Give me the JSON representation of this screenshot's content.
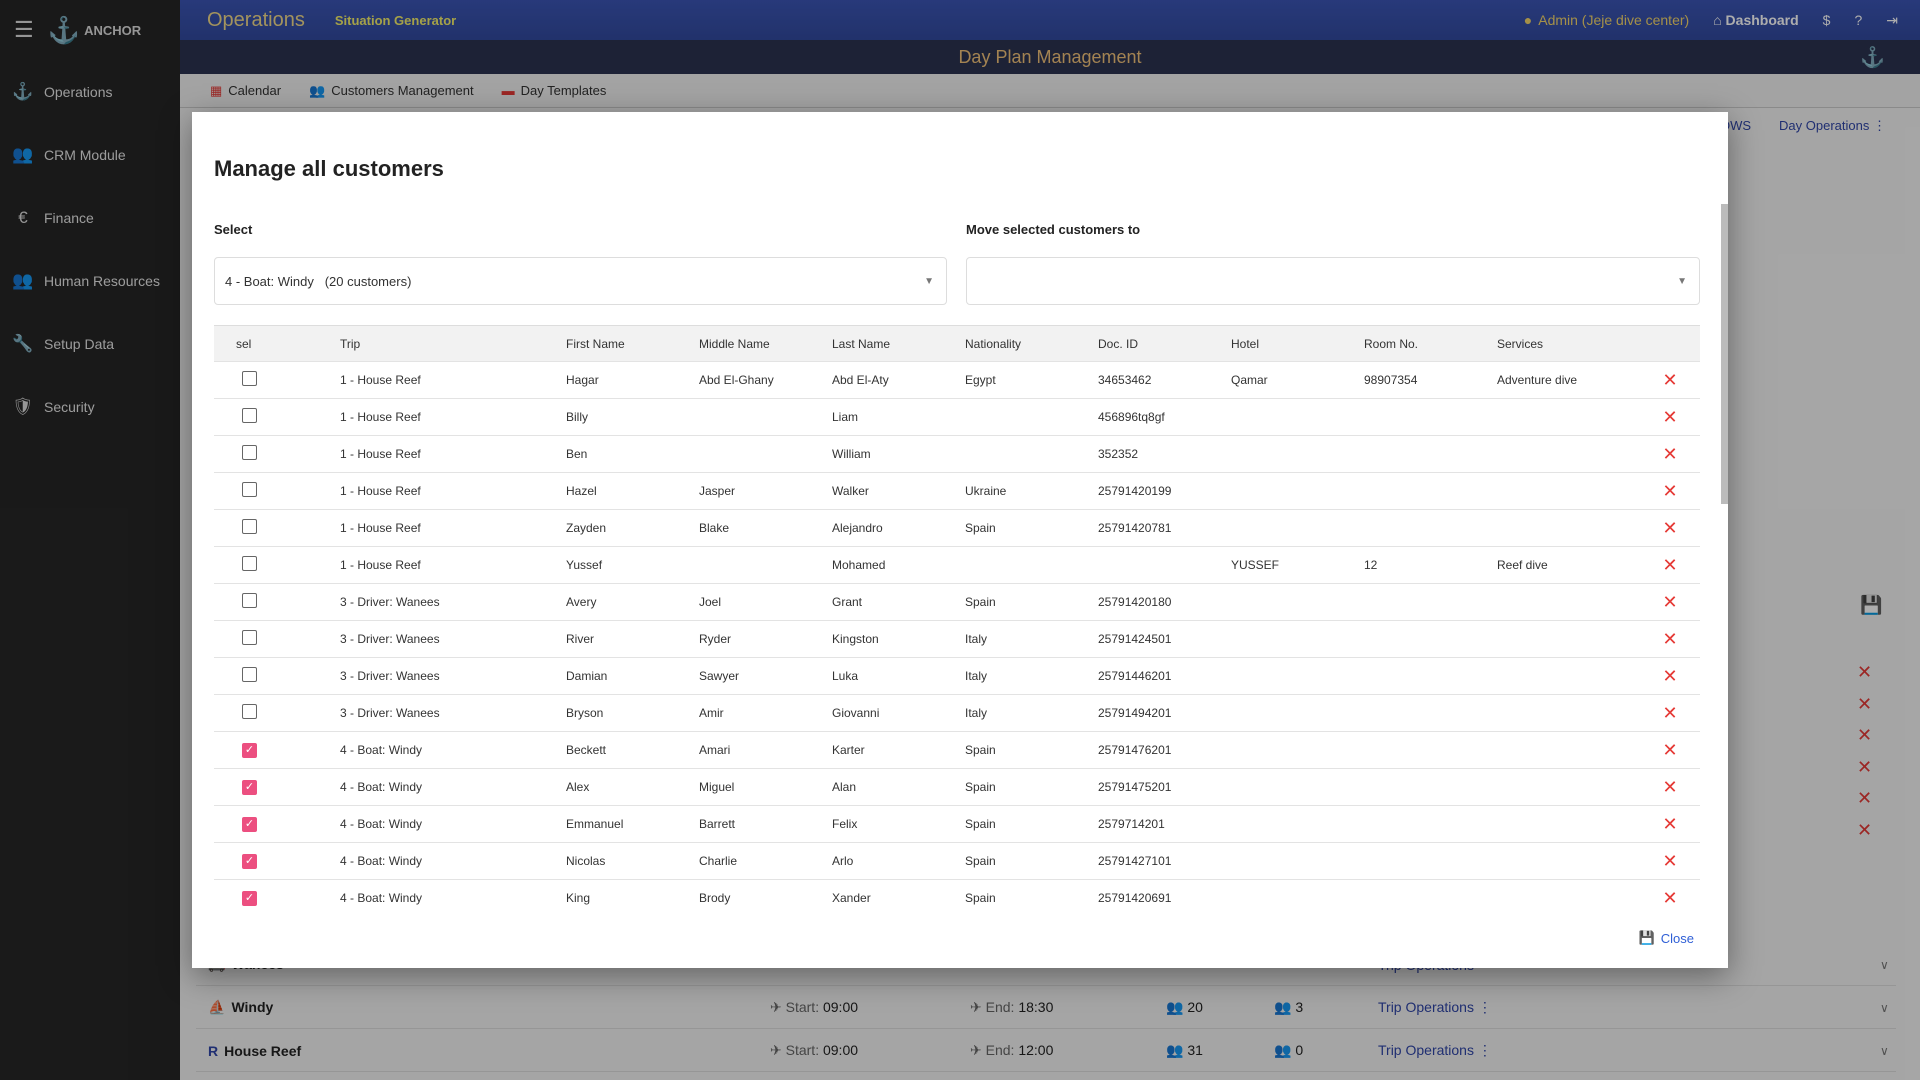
{
  "sidebar": {
    "logo": "ANCHOR",
    "items": [
      {
        "label": "Operations",
        "icon": "anchor-icon"
      },
      {
        "label": "CRM Module",
        "icon": "group-icon"
      },
      {
        "label": "Finance",
        "icon": "euro-icon"
      },
      {
        "label": "Human Resources",
        "icon": "people-icon"
      },
      {
        "label": "Setup Data",
        "icon": "wrench-icon"
      },
      {
        "label": "Security",
        "icon": "shield-icon"
      }
    ]
  },
  "topbar": {
    "app_title": "Operations",
    "situation": "Situation Generator",
    "user": "Admin (Jeje dive center)",
    "dashboard": "Dashboard"
  },
  "subbar": {
    "title": "Day Plan Management"
  },
  "tabs": [
    {
      "label": "Calendar"
    },
    {
      "label": "Customers Management"
    },
    {
      "label": "Day Templates"
    }
  ],
  "background": {
    "rows_tab": "OWS",
    "day_operations": "Day Operations",
    "trips": [
      {
        "name": "Wanees",
        "start": "",
        "end": "",
        "customers": "",
        "staff": "",
        "action": "Trip Operations"
      },
      {
        "name": "Windy",
        "start_label": "Start:",
        "start": "09:00",
        "end_label": "End:",
        "end": "18:30",
        "customers": "20",
        "staff": "3",
        "action": "Trip Operations"
      },
      {
        "name": "House Reef",
        "start_label": "Start:",
        "start": "09:00",
        "end_label": "End:",
        "end": "12:00",
        "customers": "31",
        "staff": "0",
        "action": "Trip Operations"
      }
    ]
  },
  "modal": {
    "title": "Manage all customers",
    "select_label": "Select",
    "select_value": "4 - Boat: Windy   (20 customers)",
    "move_label": "Move selected customers to",
    "move_value": "",
    "close_label": "Close",
    "columns": [
      "sel",
      "Trip",
      "First Name",
      "Middle Name",
      "Last Name",
      "Nationality",
      "Doc. ID",
      "Hotel",
      "Room No.",
      "Services"
    ],
    "rows": [
      [
        "false",
        "1 - House Reef",
        "Hagar",
        "Abd El-Ghany",
        "Abd El-Aty",
        "Egypt",
        "34653462",
        "Qamar",
        "98907354",
        "Adventure dive"
      ],
      [
        "false",
        "1 - House Reef",
        "Billy",
        "",
        "Liam",
        "",
        "456896tq8gf",
        "",
        "",
        ""
      ],
      [
        "false",
        "1 - House Reef",
        "Ben",
        "",
        "William",
        "",
        "352352",
        "",
        "",
        ""
      ],
      [
        "false",
        "1 - House Reef",
        "Hazel",
        "Jasper",
        "Walker",
        "Ukraine",
        "25791420199",
        "",
        "",
        ""
      ],
      [
        "false",
        "1 - House Reef",
        "Zayden",
        "Blake",
        "Alejandro",
        "Spain",
        "25791420781",
        "",
        "",
        ""
      ],
      [
        "false",
        "1 - House Reef",
        "Yussef",
        "",
        "Mohamed",
        "",
        "",
        "YUSSEF",
        "12",
        "Reef dive"
      ],
      [
        "false",
        "3 - Driver: Wanees",
        "Avery",
        "Joel",
        "Grant",
        "Spain",
        "25791420180",
        "",
        "",
        ""
      ],
      [
        "false",
        "3 - Driver: Wanees",
        "River",
        "Ryder",
        "Kingston",
        "Italy",
        "25791424501",
        "",
        "",
        ""
      ],
      [
        "false",
        "3 - Driver: Wanees",
        "Damian",
        "Sawyer",
        "Luka",
        "Italy",
        "25791446201",
        "",
        "",
        ""
      ],
      [
        "false",
        "3 - Driver: Wanees",
        "Bryson",
        "Amir",
        "Giovanni",
        "Italy",
        "25791494201",
        "",
        "",
        ""
      ],
      [
        "true",
        "4 - Boat: Windy",
        "Beckett",
        "Amari",
        "Karter",
        "Spain",
        "25791476201",
        "",
        "",
        ""
      ],
      [
        "true",
        "4 - Boat: Windy",
        "Alex",
        "Miguel",
        "Alan",
        "Spain",
        "25791475201",
        "",
        "",
        ""
      ],
      [
        "true",
        "4 - Boat: Windy",
        "Emmanuel",
        "Barrett",
        "Felix",
        "Spain",
        "2579714201",
        "",
        "",
        ""
      ],
      [
        "true",
        "4 - Boat: Windy",
        "Nicolas",
        "Charlie",
        "Arlo",
        "Spain",
        "25791427101",
        "",
        "",
        ""
      ],
      [
        "true",
        "4 - Boat: Windy",
        "King",
        "Brody",
        "Xander",
        "Spain",
        "25791420691",
        "",
        "",
        ""
      ]
    ]
  },
  "colors": {
    "accent": "#ec4f80",
    "delete": "#e53935",
    "header": "#3b55b5",
    "link": "#3046a8"
  }
}
